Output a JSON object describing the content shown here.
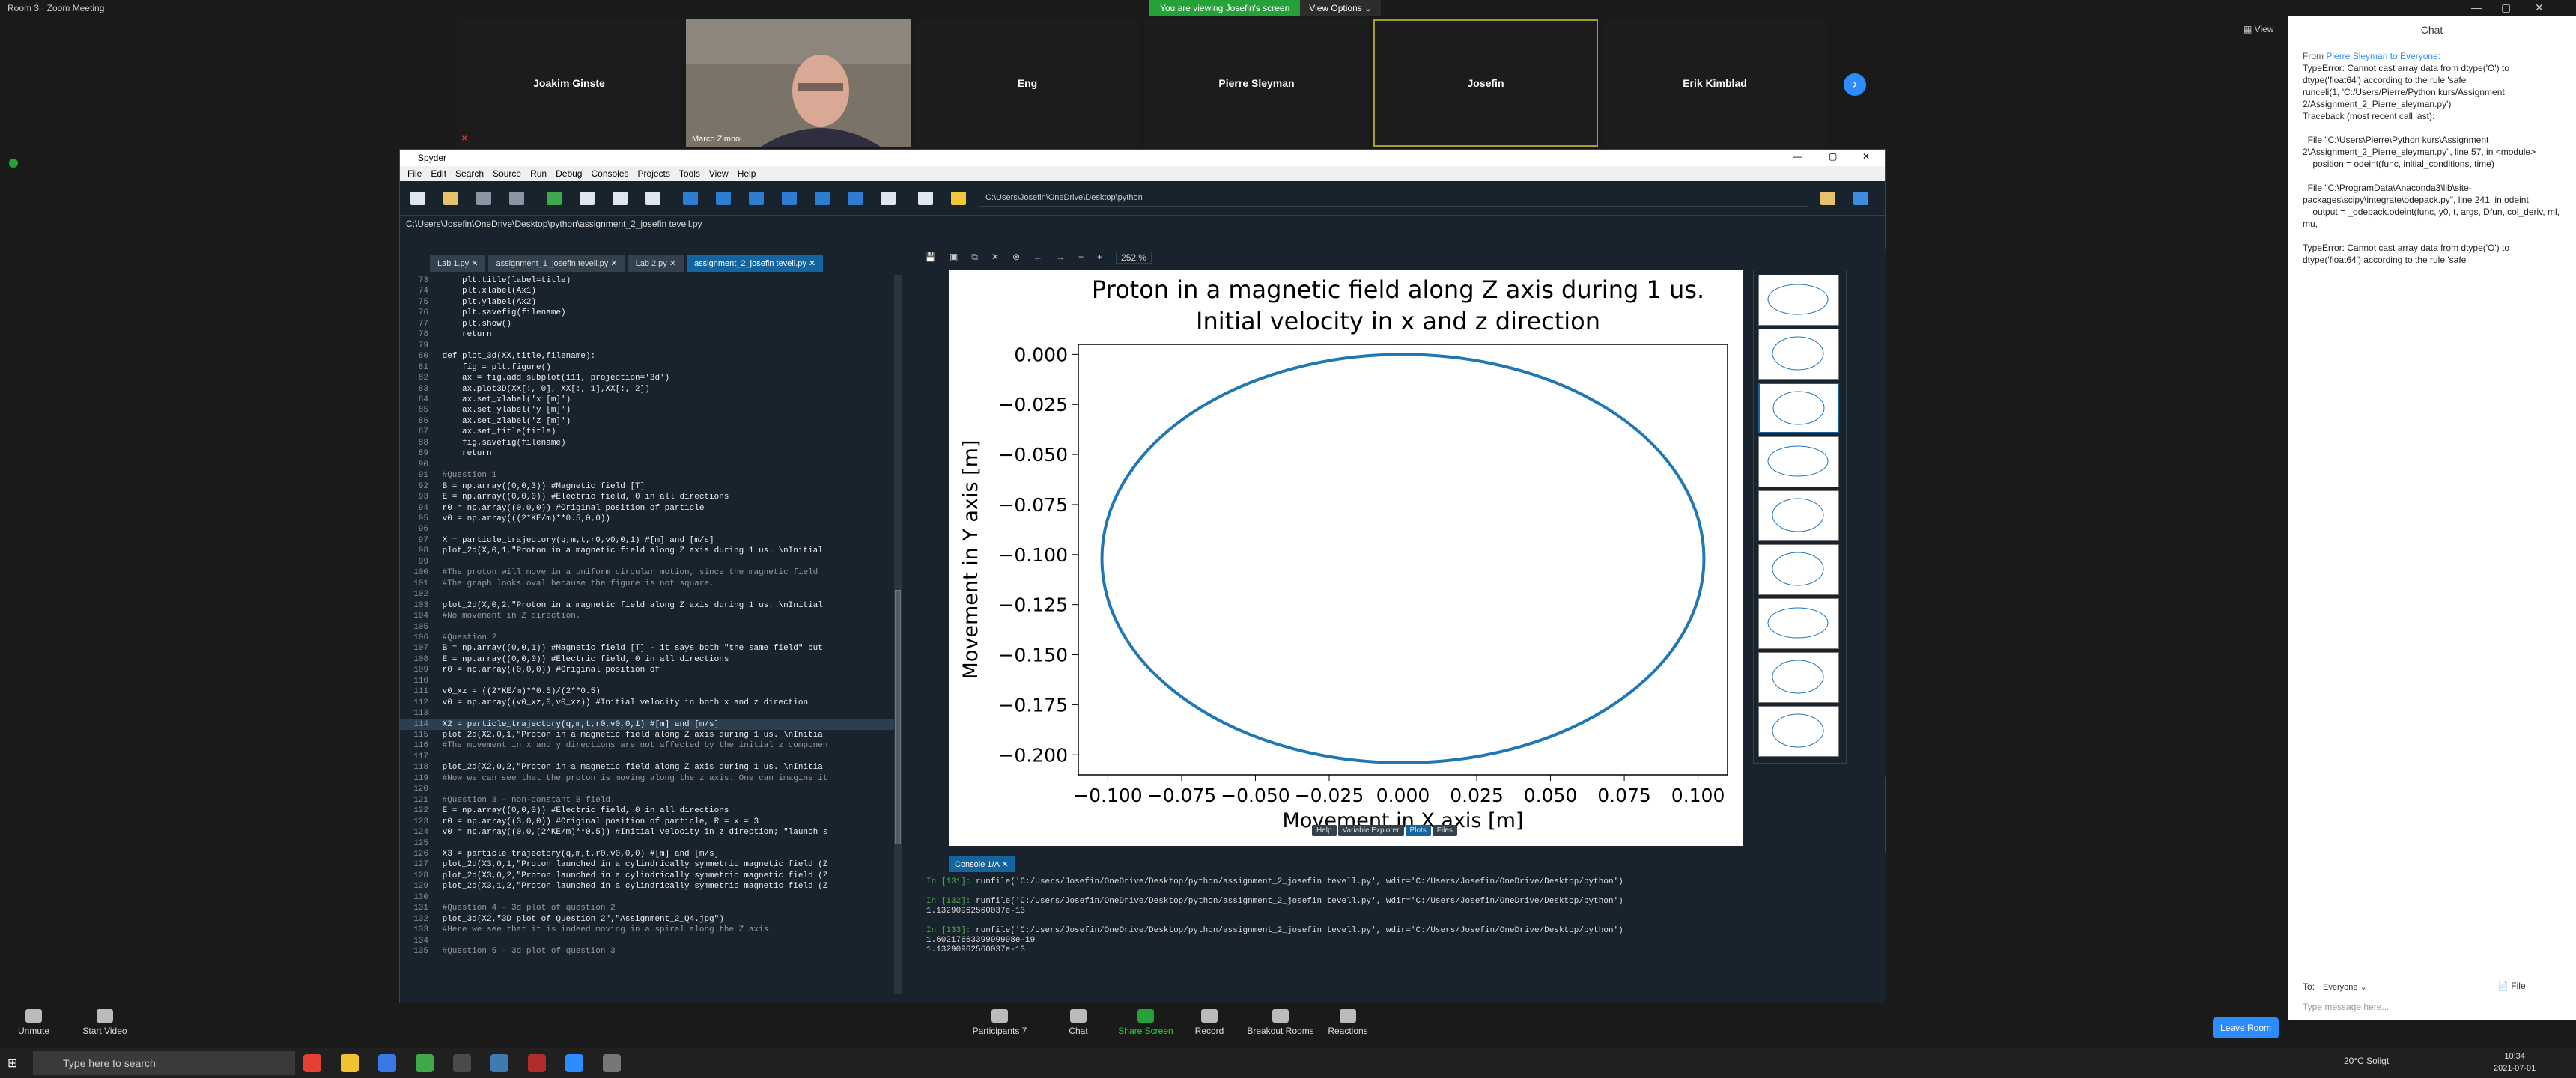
{
  "window": {
    "title": "Room 3 · Zoom Meeting",
    "banner": "You are viewing Josefin's screen",
    "view_options": "View Options ⌄",
    "view_btn": "View",
    "minimize": "—",
    "maximize": "▢",
    "close": "✕"
  },
  "participants": [
    {
      "name": "Joakim Ginste",
      "muted": true
    },
    {
      "name": "Marco Zimnol",
      "video": true,
      "muted": true
    },
    {
      "name": "Eng",
      "muted": false
    },
    {
      "name": "Pierre Sleyman",
      "muted": false
    },
    {
      "name": "Josefin",
      "active": true,
      "muted": false
    },
    {
      "name": "Erik Kimblad",
      "muted": false
    }
  ],
  "spyder": {
    "title": "Spyder",
    "menu": [
      "File",
      "Edit",
      "Search",
      "Source",
      "Run",
      "Debug",
      "Consoles",
      "Projects",
      "Tools",
      "View",
      "Help"
    ],
    "path": "C:\\Users\\Josefin\\OneDrive\\Desktop\\python",
    "crumb": "C:\\Users\\Josefin\\OneDrive\\Desktop\\python\\assignment_2_josefin tevell.py",
    "tabs": [
      "Lab 1.py",
      "assignment_1_josefin tevell.py",
      "Lab 2.py",
      "assignment_2_josefin tevell.py"
    ],
    "zoom": "252 %",
    "code": [
      {
        "n": "73",
        "t": "     plt.title(label=title)"
      },
      {
        "n": "74",
        "t": "     plt.xlabel(Ax1)"
      },
      {
        "n": "75",
        "t": "     plt.ylabel(Ax2)"
      },
      {
        "n": "76",
        "t": "     plt.savefig(filename)"
      },
      {
        "n": "77",
        "t": "     plt.show()"
      },
      {
        "n": "78",
        "t": "     return"
      },
      {
        "n": "79",
        "t": ""
      },
      {
        "n": "80",
        "t": " def plot_3d(XX,title,filename):"
      },
      {
        "n": "81",
        "t": "     fig = plt.figure()"
      },
      {
        "n": "82",
        "t": "     ax = fig.add_subplot(111, projection='3d')"
      },
      {
        "n": "83",
        "t": "     ax.plot3D(XX[:, 0], XX[:, 1],XX[:, 2])"
      },
      {
        "n": "84",
        "t": "     ax.set_xlabel('x [m]')"
      },
      {
        "n": "85",
        "t": "     ax.set_ylabel('y [m]')"
      },
      {
        "n": "86",
        "t": "     ax.set_zlabel('z [m]')"
      },
      {
        "n": "87",
        "t": "     ax.set_title(title)"
      },
      {
        "n": "88",
        "t": "     fig.savefig(filename)"
      },
      {
        "n": "89",
        "t": "     return"
      },
      {
        "n": "90",
        "t": ""
      },
      {
        "n": "91",
        "t": " #Question 1"
      },
      {
        "n": "92",
        "t": " B = np.array((0,0,3)) #Magnetic field [T]"
      },
      {
        "n": "93",
        "t": " E = np.array((0,0,0)) #Electric field, 0 in all directions"
      },
      {
        "n": "94",
        "t": " r0 = np.array((0,0,0)) #Original position of particle"
      },
      {
        "n": "95",
        "t": " v0 = np.array(((2*KE/m)**0.5,0,0))"
      },
      {
        "n": "96",
        "t": ""
      },
      {
        "n": "97",
        "t": " X = particle_trajectory(q,m,t,r0,v0,0,1) #[m] and [m/s]"
      },
      {
        "n": "98",
        "t": " plot_2d(X,0,1,\"Proton in a magnetic field along Z axis during 1 us. \\nInitial"
      },
      {
        "n": "99",
        "t": ""
      },
      {
        "n": "100",
        "t": " #The proton will move in a uniform circular motion, since the magnetic field"
      },
      {
        "n": "101",
        "t": " #The graph looks oval because the figure is not square."
      },
      {
        "n": "102",
        "t": ""
      },
      {
        "n": "103",
        "t": " plot_2d(X,0,2,\"Proton in a magnetic field along Z axis during 1 us. \\nInitial"
      },
      {
        "n": "104",
        "t": " #No movement in Z direction."
      },
      {
        "n": "105",
        "t": ""
      },
      {
        "n": "106",
        "t": " #Question 2"
      },
      {
        "n": "107",
        "t": " B = np.array((0,0,1)) #Magnetic field [T] - it says both \"the same field\" but"
      },
      {
        "n": "108",
        "t": " E = np.array((0,0,0)) #Electric field, 0 in all directions"
      },
      {
        "n": "109",
        "t": " r0 = np.array((0,0,0)) #Original position of"
      },
      {
        "n": "110",
        "t": ""
      },
      {
        "n": "111",
        "t": " v0_xz = ((2*KE/m)**0.5)/(2**0.5)"
      },
      {
        "n": "112",
        "t": " v0 = np.array((v0_xz,0,v0_xz)) #Initial velocity in both x and z direction"
      },
      {
        "n": "113",
        "t": ""
      },
      {
        "n": "114",
        "t": " X2 = particle_trajectory(q,m,t,r0,v0,0,1) #[m] and [m/s]"
      },
      {
        "n": "115",
        "t": " plot_2d(X2,0,1,\"Proton in a magnetic field along Z axis during 1 us. \\nInitia"
      },
      {
        "n": "116",
        "t": " #The movement in x and y directions are not affected by the initial z componen"
      },
      {
        "n": "117",
        "t": ""
      },
      {
        "n": "118",
        "t": " plot_2d(X2,0,2,\"Proton in a magnetic field along Z axis during 1 us. \\nInitia"
      },
      {
        "n": "119",
        "t": " #Now we can see that the proton is moving along the z axis. One can imagine it"
      },
      {
        "n": "120",
        "t": ""
      },
      {
        "n": "121",
        "t": " #Question 3 - non-constant B field."
      },
      {
        "n": "122",
        "t": " E = np.array((0,0,0)) #Electric field, 0 in all directions"
      },
      {
        "n": "123",
        "t": " r0 = np.array((3,0,0)) #Original position of particle, R = x = 3"
      },
      {
        "n": "124",
        "t": " v0 = np.array((0,0,(2*KE/m)**0.5)) #Initial velocity in z direction; \"launch s"
      },
      {
        "n": "125",
        "t": ""
      },
      {
        "n": "126",
        "t": " X3 = particle_trajectory(q,m,t,r0,v0,0,0) #[m] and [m/s]"
      },
      {
        "n": "127",
        "t": " plot_2d(X3,0,1,\"Proton launched in a cylindrically symmetric magnetic field (Z"
      },
      {
        "n": "128",
        "t": " plot_2d(X3,0,2,\"Proton launched in a cylindrically symmetric magnetic field (Z"
      },
      {
        "n": "129",
        "t": " plot_2d(X3,1,2,\"Proton launched in a cylindrically symmetric magnetic field (Z"
      },
      {
        "n": "130",
        "t": ""
      },
      {
        "n": "131",
        "t": " #Question 4 - 3d plot of question 2"
      },
      {
        "n": "132",
        "t": " plot_3d(X2,\"3D plot of Question 2\",\"Assignment_2_Q4.jpg\")"
      },
      {
        "n": "133",
        "t": " #Here we see that it is indeed moving in a spiral along the Z axis."
      },
      {
        "n": "134",
        "t": ""
      },
      {
        "n": "135",
        "t": " #Question 5 - 3d plot of question 3"
      }
    ],
    "highlight_line": "114",
    "pane_tabs": [
      "Help",
      "Variable Explorer",
      "Plots",
      "Files"
    ],
    "console_tab": "Console 1/A",
    "console_lines": [
      {
        "prompt": "In [131]:",
        "text": " runfile('C:/Users/Josefin/OneDrive/Desktop/python/assignment_2_josefin tevell.py', wdir='C:/Users/Josefin/OneDrive/Desktop/python')"
      },
      {
        "prompt": "",
        "text": ""
      },
      {
        "prompt": "In [132]:",
        "text": " runfile('C:/Users/Josefin/OneDrive/Desktop/python/assignment_2_josefin tevell.py', wdir='C:/Users/Josefin/OneDrive/Desktop/python')"
      },
      {
        "prompt": "",
        "text": "1.13290962560037e-13"
      },
      {
        "prompt": "",
        "text": ""
      },
      {
        "prompt": "In [133]:",
        "text": " runfile('C:/Users/Josefin/OneDrive/Desktop/python/assignment_2_josefin tevell.py', wdir='C:/Users/Josefin/OneDrive/Desktop/python')"
      },
      {
        "prompt": "",
        "text": "1.6021766339999998e-19"
      },
      {
        "prompt": "",
        "text": "1.13290962560037e-13"
      }
    ]
  },
  "chart_data": {
    "type": "line",
    "title": "Proton in a magnetic field along Z axis during 1 us.\nInitial velocity in x and z direction",
    "title_lines": [
      "Proton in a magnetic field along Z axis during 1 us.",
      "Initial velocity in x and z direction"
    ],
    "xlabel": "Movement in X axis [m]",
    "ylabel": "Movement in Y axis [m]",
    "xlim": [
      -0.11,
      0.11
    ],
    "ylim": [
      -0.21,
      0.005
    ],
    "xticks": [
      "−0.100",
      "−0.075",
      "−0.050",
      "−0.025",
      "0.000",
      "0.025",
      "0.050",
      "0.075",
      "0.100"
    ],
    "xtick_values": [
      -0.1,
      -0.075,
      -0.05,
      -0.025,
      0,
      0.025,
      0.05,
      0.075,
      0.1
    ],
    "yticks": [
      "0.000",
      "−0.025",
      "−0.050",
      "−0.075",
      "−0.100",
      "−0.125",
      "−0.150",
      "−0.175",
      "−0.200"
    ],
    "ytick_values": [
      0,
      -0.025,
      -0.05,
      -0.075,
      -0.1,
      -0.125,
      -0.15,
      -0.175,
      -0.2
    ],
    "series": [
      {
        "shape": "circle",
        "center": [
          0,
          -0.102
        ],
        "radius": 0.102,
        "color": "#1f77b4"
      }
    ],
    "grid": false
  },
  "chat": {
    "title": "Chat",
    "from_prefix": "From ",
    "from": "Pierre Sleyman to Everyone:",
    "message": "TypeError: Cannot cast array data from dtype('O') to dtype('float64') according to the rule 'safe'\nrunceli(1, 'C:/Users/Pierre/Python kurs/Assignment 2/Assignment_2_Pierre_sleyman.py')\nTraceback (most recent call last):\n\n  File \"C:\\Users\\Pierre\\Python kurs\\Assignment 2\\Assignment_2_Pierre_sleyman.py\", line 57, in <module>\n    position = odeint(func, initial_conditions, time)\n\n  File \"C:\\ProgramData\\Anaconda3\\lib\\site-packages\\scipy\\integrate\\odepack.py\", line 241, in odeint\n    output = _odepack.odeint(func, y0, t, args, Dfun, col_deriv, ml, mu,\n\nTypeError: Cannot cast array data from dtype('O') to dtype('float64') according to the rule 'safe'",
    "to_label": "To:",
    "to_value": "Everyone ⌄",
    "file_btn": "File",
    "placeholder": "Type message here..."
  },
  "zoom_bar": {
    "unmute": "Unmute",
    "start_video": "Start Video",
    "participants": "Participants",
    "participants_count": "7",
    "chat": "Chat",
    "share": "Share Screen",
    "record": "Record",
    "breakout": "Breakout Rooms",
    "reactions": "Reactions",
    "leave": "Leave Room"
  },
  "taskbar": {
    "search_placeholder": "Type here to search",
    "weather": "20°C  Soligt",
    "time": "10:34",
    "date": "2021-07-01"
  }
}
